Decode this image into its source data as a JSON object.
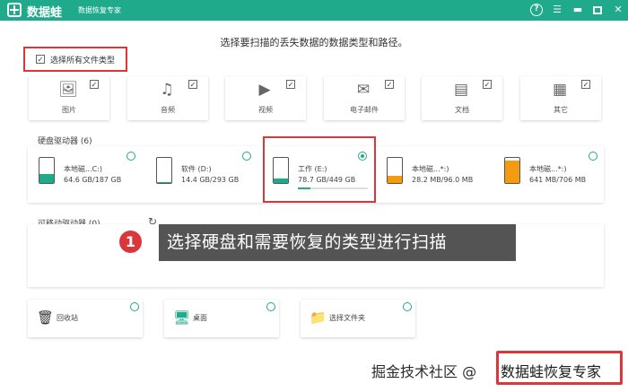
{
  "app": {
    "name": "数据蛙",
    "subtitle": "数据恢复专家",
    "help_glyph": "?"
  },
  "instruction": "选择要扫描的丢失数据的数据类型和路径。",
  "select_all": {
    "label": "选择所有文件类型",
    "checked": true
  },
  "file_types": [
    {
      "label": "图片",
      "icon": "image-icon",
      "checked": true
    },
    {
      "label": "音频",
      "icon": "music-icon",
      "checked": true
    },
    {
      "label": "视频",
      "icon": "video-icon",
      "checked": true
    },
    {
      "label": "电子邮件",
      "icon": "mail-icon",
      "checked": true
    },
    {
      "label": "文档",
      "icon": "document-icon",
      "checked": true
    },
    {
      "label": "其它",
      "icon": "grid-icon",
      "checked": true
    }
  ],
  "hard_drives": {
    "title": "硬盘驱动器 (6)",
    "items": [
      {
        "name": "本地磁...C:)",
        "size": "64.6 GB/187 GB",
        "fill": 0.35,
        "color": "#1faa8b",
        "selected": false
      },
      {
        "name": "软件 (D:)",
        "size": "14.4 GB/293 GB",
        "fill": 0.05,
        "color": "#1faa8b",
        "selected": false
      },
      {
        "name": "工作 (E:)",
        "size": "78.7 GB/449 GB",
        "fill": 0.18,
        "color": "#1faa8b",
        "selected": true
      },
      {
        "name": "本地磁...*:)",
        "size": "28.2 MB/96.0 MB",
        "fill": 0.3,
        "color": "#f39c12",
        "selected": false
      },
      {
        "name": "本地磁...*:)",
        "size": "641 MB/706 MB",
        "fill": 0.9,
        "color": "#f39c12",
        "selected": false
      }
    ]
  },
  "removable": {
    "title": "可移动驱动器 (0)"
  },
  "locations": [
    {
      "label": "回收站",
      "icon": "trash-icon"
    },
    {
      "label": "桌面",
      "icon": "desktop-icon"
    },
    {
      "label": "选择文件夹",
      "icon": "folder-icon"
    }
  ],
  "callout": {
    "number": "1",
    "text": "选择硬盘和需要恢复的类型进行扫描"
  },
  "watermark": {
    "source": "掘金技术社区 @ ",
    "brand": "数据蛙恢复专家"
  }
}
